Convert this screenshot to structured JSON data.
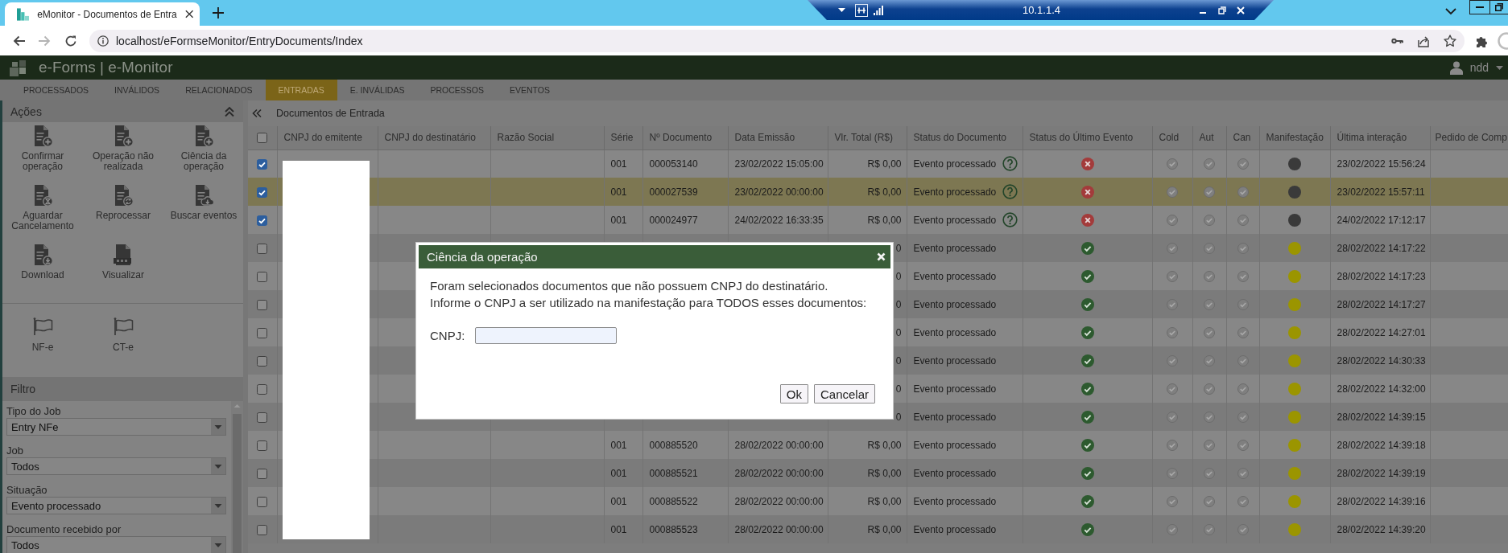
{
  "browser": {
    "tab_title": "eMonitor - Documentos de Entra",
    "address": "localhost/eFormseMonitor/EntryDocuments/Index"
  },
  "remote_bar": {
    "host": "10.1.1.4"
  },
  "app": {
    "title": "e-Forms | e-Monitor",
    "user": "ndd"
  },
  "nav": [
    {
      "label": "PROCESSADOS",
      "selected": false
    },
    {
      "label": "INVÁLIDOS",
      "selected": false
    },
    {
      "label": "RELACIONADOS",
      "selected": false
    },
    {
      "label": "ENTRADAS",
      "selected": true
    },
    {
      "label": "E. INVÁLIDAS",
      "selected": false
    },
    {
      "label": "PROCESSOS",
      "selected": false
    },
    {
      "label": "EVENTOS",
      "selected": false
    }
  ],
  "sidebar": {
    "actions_title": "Ações",
    "actions": [
      {
        "label": "Confirmar operação",
        "kind": "add"
      },
      {
        "label": "Operação não realizada",
        "kind": "add"
      },
      {
        "label": "Ciência da operação",
        "kind": "add"
      },
      {
        "label": "Aguardar Cancelamento",
        "kind": "wait"
      },
      {
        "label": "Reprocessar",
        "kind": "reprocess"
      },
      {
        "label": "Buscar eventos",
        "kind": "fetch"
      },
      {
        "label": "Download",
        "kind": "download"
      },
      {
        "label": "Visualizar",
        "kind": "pdf"
      }
    ],
    "doc_types": [
      "NF-e",
      "CT-e"
    ],
    "filter_title": "Filtro",
    "filters": [
      {
        "label": "Tipo do Job",
        "value": "Entry NFe"
      },
      {
        "label": "Job",
        "value": "Todos"
      },
      {
        "label": "Situação",
        "value": "Evento processado"
      },
      {
        "label": "Documento recebido por",
        "value": "Todos"
      }
    ]
  },
  "breadcrumb": "Documentos de Entrada",
  "table": {
    "all_checked": false,
    "columns": [
      "CNPJ do emitente",
      "CNPJ do destinatário",
      "Razão Social",
      "Série",
      "Nº Documento",
      "Data Emissão",
      "Vlr. Total (R$)",
      "Status do Documento",
      "Status do Último Evento",
      "Cold",
      "Aut",
      "Can",
      "Manifestação",
      "Última interação",
      "Pedido de Comp"
    ],
    "rows": [
      {
        "checked": true,
        "highlighted": false,
        "serie": "001",
        "number": "000053140",
        "issued": "23/02/2022 15:05:00",
        "total": "R$ 0,00",
        "status": "Evento processado",
        "help": true,
        "event_ok": false,
        "color": "#3a3a3a",
        "last_interaction": "23/02/2022 15:56:24"
      },
      {
        "checked": true,
        "highlighted": true,
        "serie": "001",
        "number": "000027539",
        "issued": "23/02/2022 00:00:00",
        "total": "R$ 0,00",
        "status": "Evento processado",
        "help": true,
        "event_ok": false,
        "color": "#3a3a3a",
        "last_interaction": "23/02/2022 15:57:11"
      },
      {
        "checked": true,
        "highlighted": false,
        "serie": "001",
        "number": "000024977",
        "issued": "24/02/2022 16:33:35",
        "total": "R$ 0,00",
        "status": "Evento processado",
        "help": true,
        "event_ok": false,
        "color": "#3a3a3a",
        "last_interaction": "24/02/2022 17:12:17"
      },
      {
        "checked": false,
        "highlighted": false,
        "total": "0",
        "status": "Evento processado",
        "help": false,
        "event_ok": true,
        "color": "#9b9500",
        "last_interaction": "28/02/2022 14:17:22"
      },
      {
        "checked": false,
        "highlighted": false,
        "total": "0",
        "status": "Evento processado",
        "help": false,
        "event_ok": true,
        "color": "#9b9500",
        "last_interaction": "28/02/2022 14:17:23"
      },
      {
        "checked": false,
        "highlighted": false,
        "total": "0",
        "status": "Evento processado",
        "help": false,
        "event_ok": true,
        "color": "#9b9500",
        "last_interaction": "28/02/2022 14:17:27"
      },
      {
        "checked": false,
        "highlighted": false,
        "total": "0",
        "status": "Evento processado",
        "help": false,
        "event_ok": true,
        "color": "#9b9500",
        "last_interaction": "28/02/2022 14:27:01"
      },
      {
        "checked": false,
        "highlighted": false,
        "total": "0",
        "status": "Evento processado",
        "help": false,
        "event_ok": true,
        "color": "#9b9500",
        "last_interaction": "28/02/2022 14:30:33"
      },
      {
        "checked": false,
        "highlighted": false,
        "total": "0",
        "status": "Evento processado",
        "help": false,
        "event_ok": true,
        "color": "#9b9500",
        "last_interaction": "28/02/2022 14:32:00"
      },
      {
        "checked": false,
        "highlighted": false,
        "total": "0",
        "status": "Evento processado",
        "help": false,
        "event_ok": true,
        "color": "#9b9500",
        "last_interaction": "28/02/2022 14:39:15"
      },
      {
        "checked": false,
        "highlighted": false,
        "serie": "001",
        "number": "000885520",
        "issued": "28/02/2022 00:00:00",
        "total": "R$ 0,00",
        "status": "Evento processado",
        "help": false,
        "event_ok": true,
        "color": "#9b9500",
        "last_interaction": "28/02/2022 14:39:18"
      },
      {
        "checked": false,
        "highlighted": false,
        "serie": "001",
        "number": "000885521",
        "issued": "28/02/2022 00:00:00",
        "total": "R$ 0,00",
        "status": "Evento processado",
        "help": false,
        "event_ok": true,
        "color": "#9b9500",
        "last_interaction": "28/02/2022 14:39:19"
      },
      {
        "checked": false,
        "highlighted": false,
        "serie": "001",
        "number": "000885522",
        "issued": "28/02/2022 00:00:00",
        "total": "R$ 0,00",
        "status": "Evento processado",
        "help": false,
        "event_ok": true,
        "color": "#9b9500",
        "last_interaction": "28/02/2022 14:39:16"
      },
      {
        "checked": false,
        "highlighted": false,
        "serie": "001",
        "number": "000885523",
        "issued": "28/02/2022 00:00:00",
        "total": "R$ 0,00",
        "status": "Evento processado",
        "help": false,
        "event_ok": true,
        "color": "#9b9500",
        "last_interaction": "28/02/2022 14:39:20"
      }
    ]
  },
  "dialog": {
    "title": "Ciência da operação",
    "message": [
      "Foram selecionados documentos que não possuem CNPJ do destinatário.",
      "Informe o CNPJ a ser utilizado na manifestação para TODOS esses documentos:"
    ],
    "field_label": "CNPJ:",
    "buttons": [
      "Ok",
      "Cancelar"
    ]
  }
}
